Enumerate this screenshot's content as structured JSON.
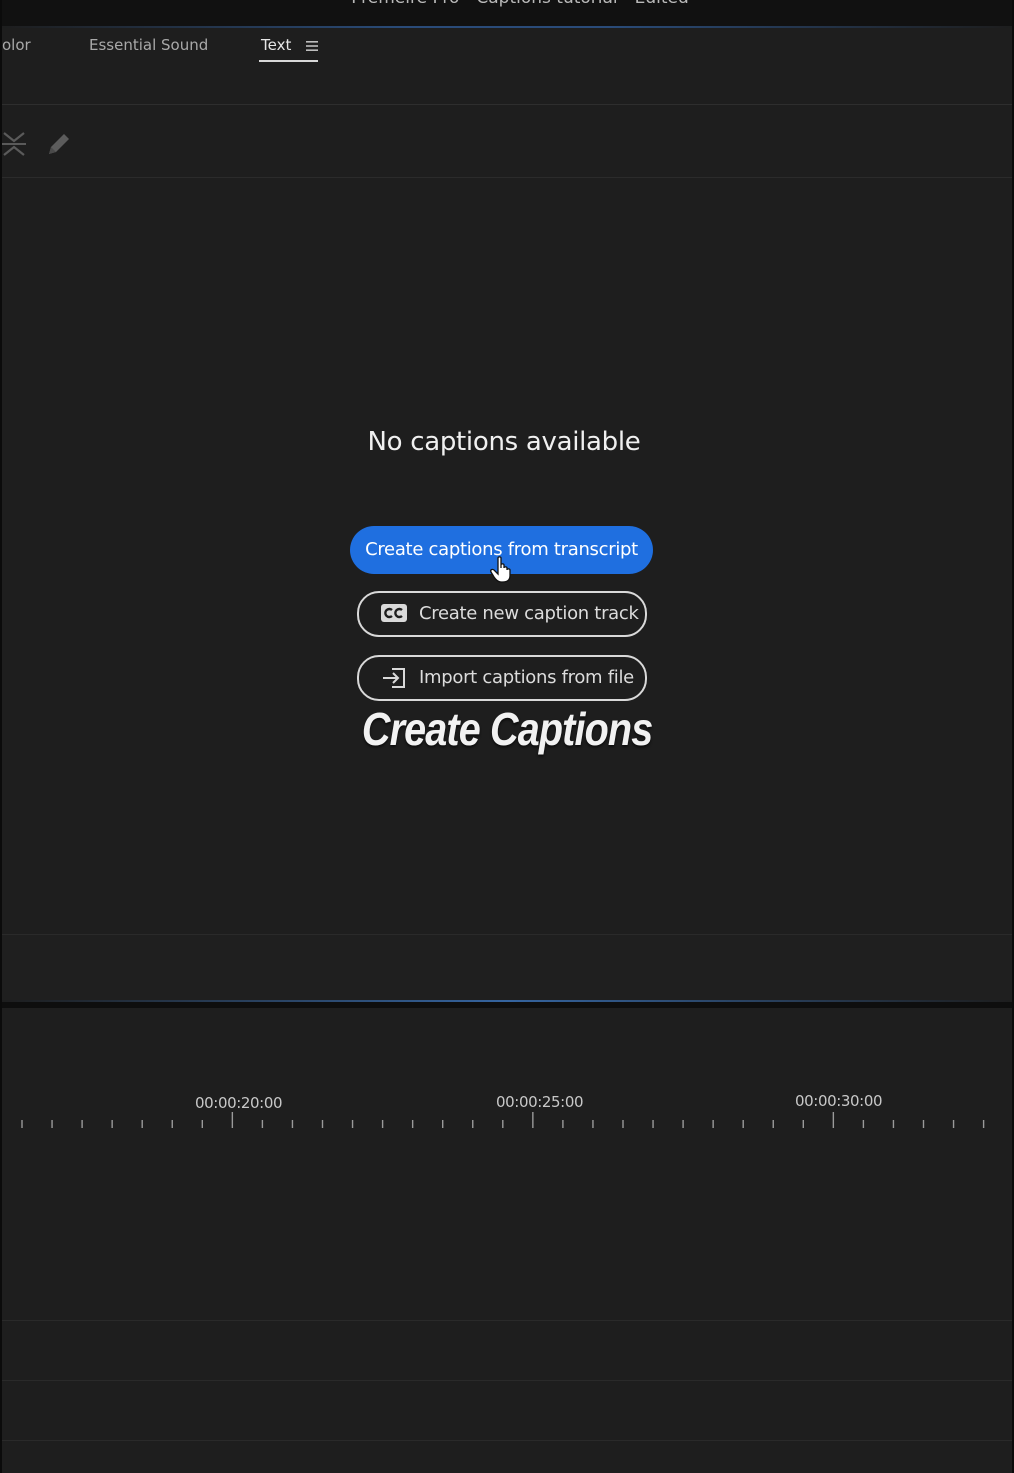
{
  "window": {
    "title": "Premeire Pro - Captions tutorial - Edited"
  },
  "tabs": [
    {
      "label": "olor"
    },
    {
      "label": "Essential Sound"
    },
    {
      "label": "Text",
      "active": true
    }
  ],
  "panel": {
    "empty_message": "No captions available",
    "primary_button": "Create captions from transcript",
    "new_track_button": "Create new caption track",
    "import_button": "Import captions from file"
  },
  "overlay": {
    "title": "Create Captions"
  },
  "timeline": {
    "timecodes": [
      "00:00:20:00",
      "00:00:25:00",
      "00:00:30:00"
    ]
  },
  "colors": {
    "accent": "#1f6fe0",
    "background": "#1e1e1e"
  },
  "icons": {
    "menu": "hamburger-menu-icon",
    "collapse": "collapse-icon",
    "edit": "pencil-icon",
    "cc": "closed-caption-icon",
    "import": "import-icon",
    "cursor": "hand-pointer-icon"
  }
}
